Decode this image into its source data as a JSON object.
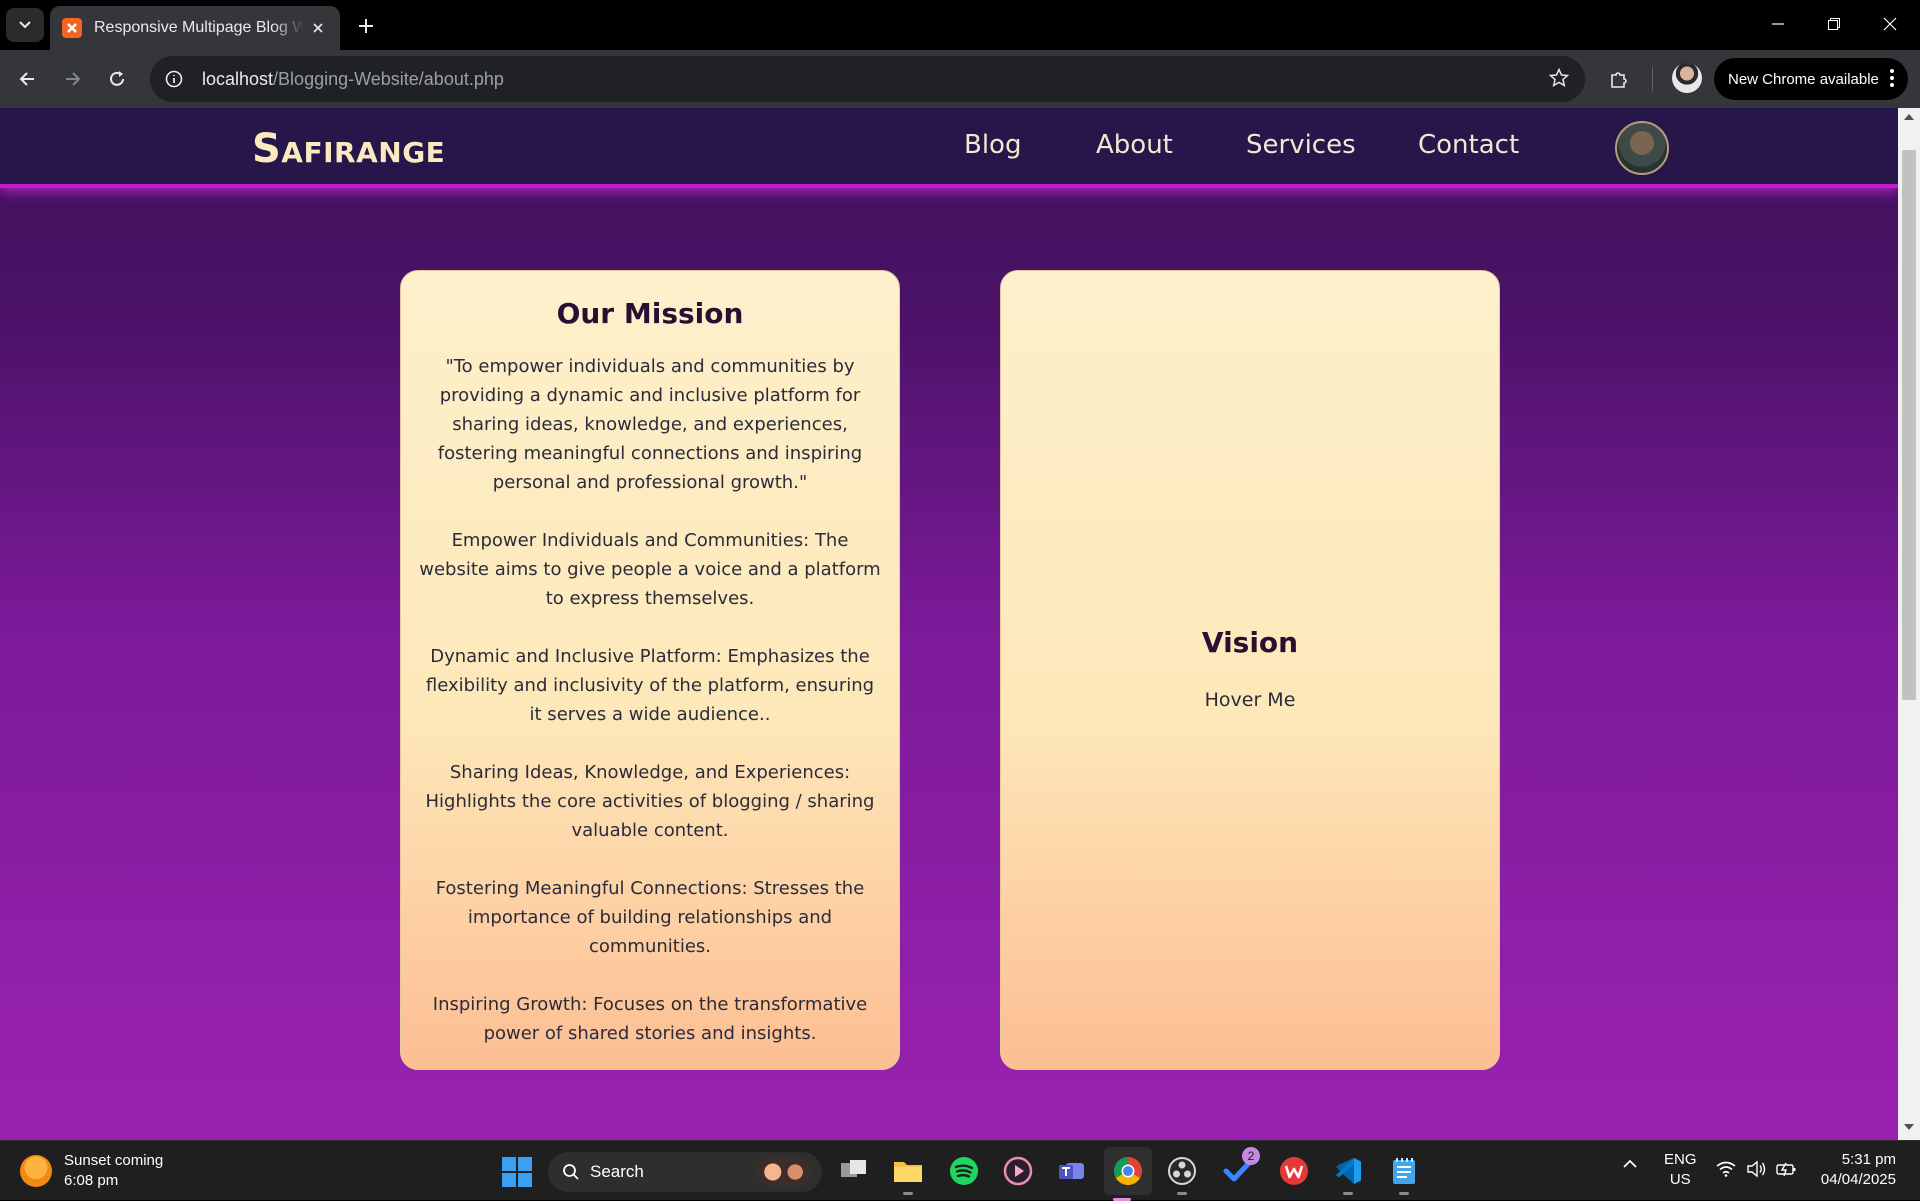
{
  "browser": {
    "tab_title": "Responsive Multipage Blog Web",
    "url_host": "localhost",
    "url_path": "/Blogging-Website/about.php",
    "update_label": "New Chrome available"
  },
  "site": {
    "logo": "Safirange",
    "nav": [
      "Blog",
      "About",
      "Services",
      "Contact"
    ]
  },
  "mission": {
    "title": "Our Mission",
    "paragraphs": [
      "\"To empower individuals and communities by providing a dynamic and inclusive platform for sharing ideas, knowledge, and experiences, fostering meaningful connections and inspiring personal and professional growth.\"",
      "Empower Individuals and Communities: The website aims to give people a voice and a platform to express themselves.",
      "Dynamic and Inclusive Platform: Emphasizes the flexibility and inclusivity of the platform, ensuring it serves a wide audience..",
      "Sharing Ideas, Knowledge, and Experiences: Highlights the core activities of blogging / sharing valuable content.",
      "Fostering Meaningful Connections: Stresses the importance of building relationships and communities.",
      "Inspiring Growth: Focuses on the transformative power of shared stories and insights."
    ]
  },
  "vision": {
    "title": "Vision",
    "hover_text": "Hover Me"
  },
  "taskbar": {
    "weather_title": "Sunset coming",
    "weather_time": "6:08 pm",
    "search_placeholder": "Search",
    "todo_badge": "2",
    "lang_top": "ENG",
    "lang_bottom": "US",
    "clock_time": "5:31 pm",
    "clock_date": "04/04/2025"
  },
  "colors": {
    "header_bg": "#261649",
    "accent_glow": "#c51bd0",
    "card_top": "#fdf0cb",
    "card_bottom": "#fdbe93",
    "heading": "#2a0f33"
  }
}
